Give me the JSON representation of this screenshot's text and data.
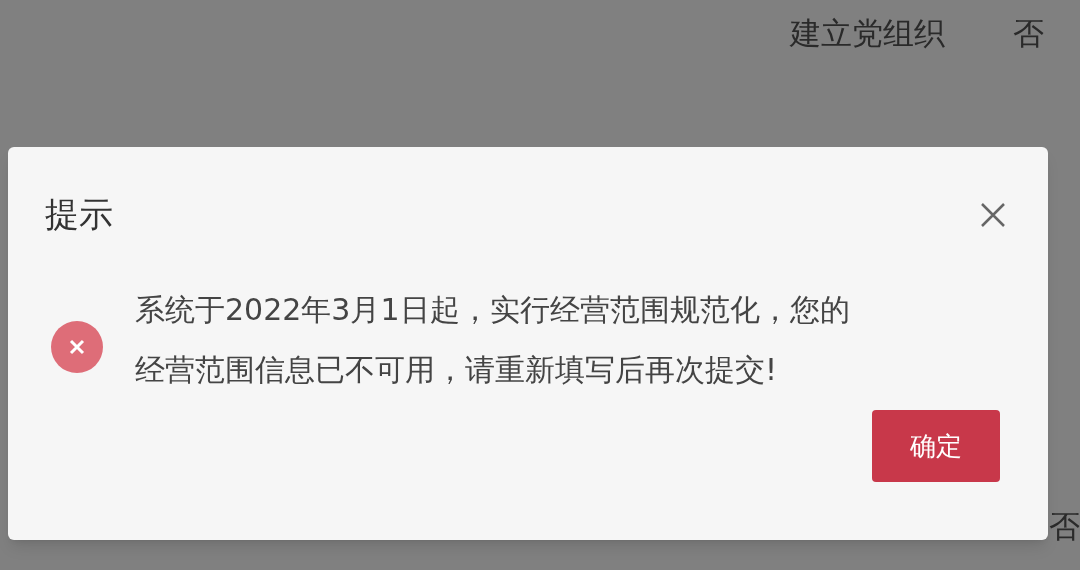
{
  "background_rows": [
    {
      "label": "建立党组织",
      "value": "否"
    },
    {
      "value": "否"
    }
  ],
  "dialog": {
    "title": "提示",
    "message": "系统于2022年3月1日起，实行经营范围规范化，您的经营范围信息已不可用，请重新填写后再次提交!",
    "kind": "error",
    "buttons": [
      "确定"
    ]
  }
}
